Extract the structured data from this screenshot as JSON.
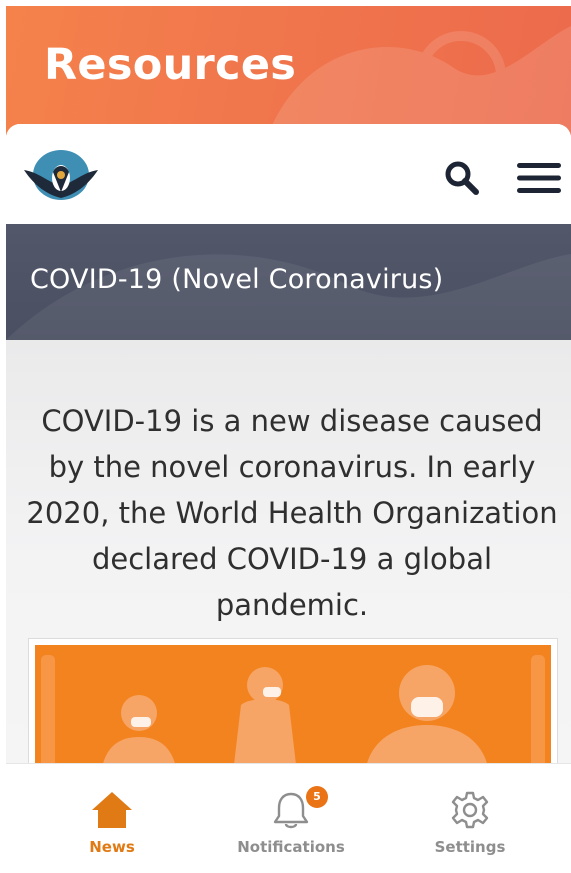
{
  "header": {
    "title": "Resources"
  },
  "navbar": {
    "logo_icon": "eagle-emblem-icon",
    "search_icon": "search-icon",
    "menu_icon": "hamburger-menu-icon"
  },
  "page": {
    "title": "COVID-19 (Novel Coronavirus)",
    "intro": "COVID-19 is a new disease caused by the novel coronavirus. In early 2020, the World Health Organization declared COVID-19 a global pandemic."
  },
  "tabs": [
    {
      "label": "News",
      "icon": "home-icon",
      "active": true
    },
    {
      "label": "Notifications",
      "icon": "bell-icon",
      "badge": "5"
    },
    {
      "label": "Settings",
      "icon": "gear-icon"
    }
  ],
  "colors": {
    "header_orange": "#f0764c",
    "title_band": "#4f5567",
    "accent_orange": "#e07a14",
    "banner_orange": "#f3831f"
  }
}
